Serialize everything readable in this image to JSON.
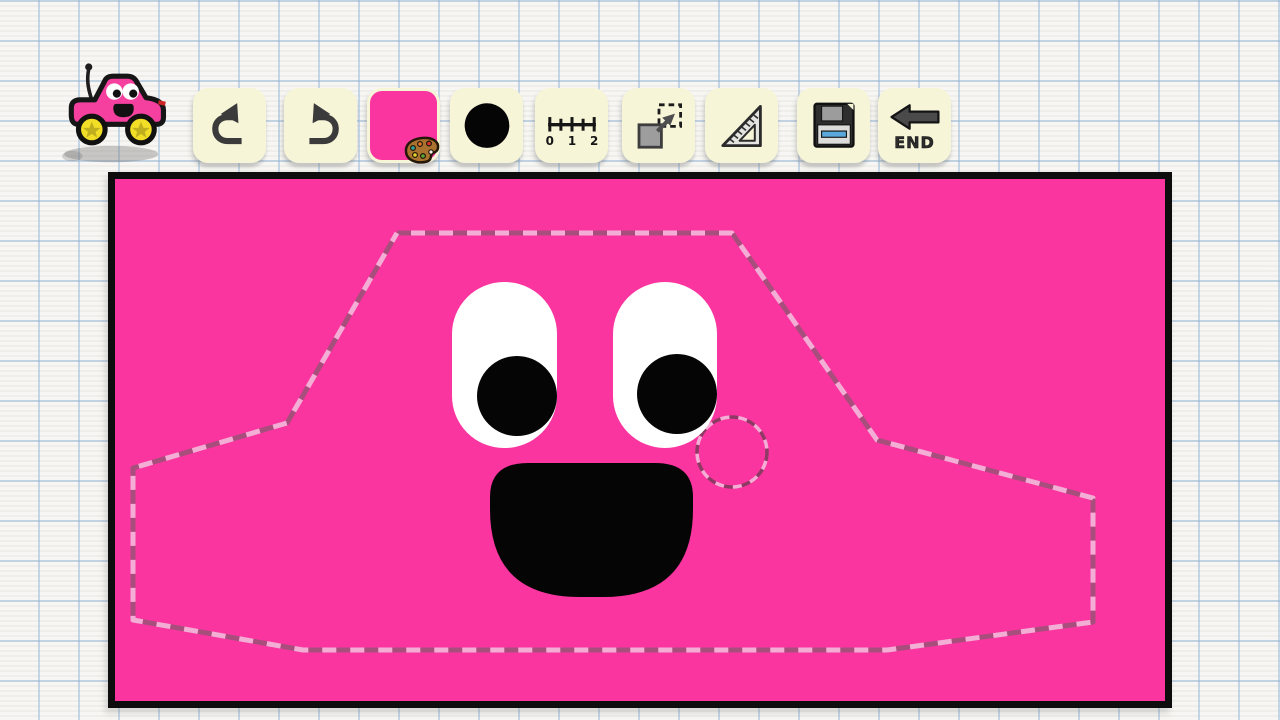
{
  "app": {
    "description": "cartoon car livery paint editor on graph paper"
  },
  "mascot": {
    "name": "pink RC car mascot with antenna, star wheels and smiling face"
  },
  "toolbar": {
    "undo": {
      "tooltip": "undo"
    },
    "redo": {
      "tooltip": "redo"
    },
    "color_picker": {
      "tooltip": "color picker",
      "selected_color": "#fb35a0"
    },
    "brush": {
      "tooltip": "brush size",
      "brush_color": "#000000"
    },
    "ruler": {
      "tooltip": "ruler",
      "tick_labels": [
        "0",
        "1",
        "2"
      ]
    },
    "transform": {
      "tooltip": "move / transform selection"
    },
    "set_square": {
      "tooltip": "set square triangle ruler"
    },
    "save": {
      "tooltip": "save"
    },
    "end": {
      "tooltip": "finish editing",
      "label": "END"
    }
  },
  "canvas": {
    "background_color": "#fb35a0",
    "border_color": "#0d0d0d",
    "drawing": {
      "selection_outline": "dashed car-silhouette polygon",
      "cursor": "small dashed circle",
      "face": {
        "eyes": "two white pill-shaped eyes with black pupils looking down-right",
        "mouth": "large black open smile"
      }
    }
  },
  "colors": {
    "paper": "#f3f2ee",
    "grid_line": "#94b6d8",
    "button_cream": "#f7f5d8",
    "canvas_pink": "#fb35a0",
    "dash_dark": "#a84e7c",
    "dash_light": "#f2aed4",
    "icon_dark": "#3b3b3b",
    "wheel_yellow": "#f2de26",
    "floppy_blue": "#5aa7dc"
  }
}
